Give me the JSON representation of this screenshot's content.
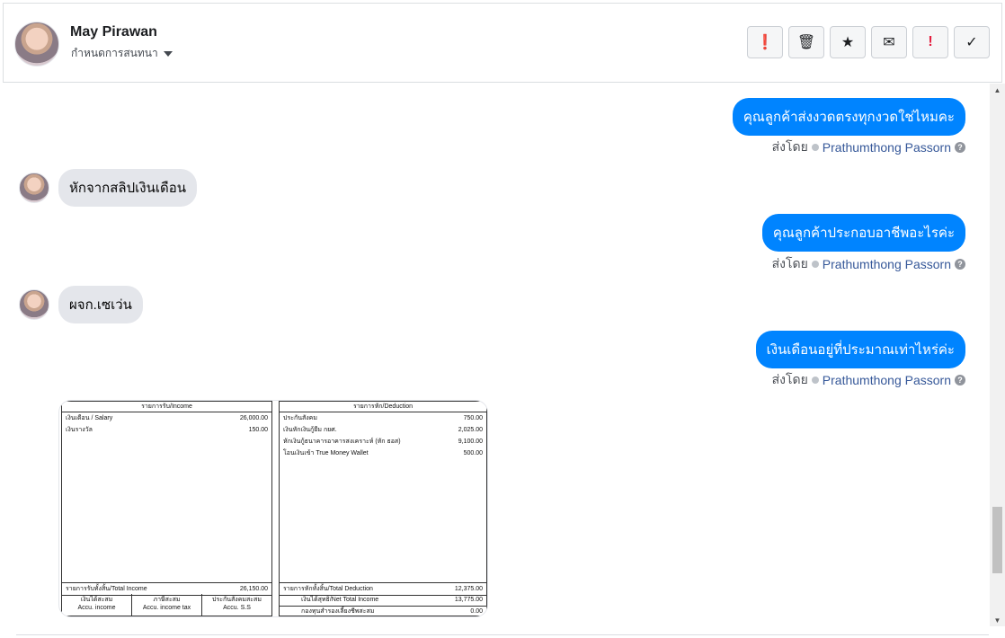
{
  "header": {
    "contact_name": "May Pirawan",
    "assign_label": "กำหนดการสนทนา",
    "actions": [
      {
        "name": "alert-button",
        "icon": "exclamation-circle-icon",
        "glyph": "❗"
      },
      {
        "name": "delete-button",
        "icon": "trash-icon",
        "glyph": "🗑"
      },
      {
        "name": "star-button",
        "icon": "star-icon",
        "glyph": "★"
      },
      {
        "name": "mark-unread-button",
        "icon": "envelope-icon",
        "glyph": "✉"
      },
      {
        "name": "spam-button",
        "icon": "exclamation-icon",
        "glyph": "!"
      },
      {
        "name": "done-button",
        "icon": "check-icon",
        "glyph": "✓"
      }
    ]
  },
  "messages": [
    {
      "direction": "out",
      "text": "คุณลูกค้าส่งงวดตรงทุกงวดใช่ไหมคะ"
    },
    {
      "direction": "in",
      "text": "หักจากสลิปเงินเดือน"
    },
    {
      "direction": "out",
      "text": "คุณลูกค้าประกอบอาชีพอะไรค่ะ"
    },
    {
      "direction": "in",
      "text": "ผจก.เซเว่น"
    },
    {
      "direction": "out",
      "text": "เงินเดือนอยู่ที่ประมาณเท่าไหร่ค่ะ"
    }
  ],
  "sent_by": {
    "prefix": "ส่งโดย",
    "agent": "Prathumthong Passorn"
  },
  "slip": {
    "income_header": "รายการรับ/Income",
    "income_items": [
      {
        "label": "เงินเดือน / Salary",
        "amount": "26,000.00"
      },
      {
        "label": "เงินรางวัล",
        "amount": "150.00"
      }
    ],
    "income_total_label": "รายการรับทั้งสิ้น/Total Income",
    "income_total": "26,150.00",
    "accum": [
      {
        "th": "เงินได้สะสม",
        "en": "Accu. income"
      },
      {
        "th": "ภาษีสะสม",
        "en": "Accu. income tax"
      },
      {
        "th": "ประกันสังคมสะสม",
        "en": "Accu. S.S"
      }
    ],
    "deduction_header": "รายการหัก/Deduction",
    "deduction_items": [
      {
        "label": "ประกันสังคม",
        "amount": "750.00"
      },
      {
        "label": "เงินหักเงินกู้ยืม กยศ.",
        "amount": "2,025.00"
      },
      {
        "label": "หักเงินกู้ธนาคารอาคารสงเคราะห์ (หัก ธอส)",
        "amount": "9,100.00"
      },
      {
        "label": "โอนเงินเข้า True Money Wallet",
        "amount": "500.00"
      }
    ],
    "deduction_total_label": "รายการหักทั้งสิ้น/Total Deduction",
    "deduction_total": "12,375.00",
    "net_label": "เงินได้สุทธิ/Net Total Income",
    "net_total": "13,775.00",
    "fund_label": "กองทุนสำรองเลี้ยงชีพสะสม",
    "fund_total": "0.00"
  },
  "colors": {
    "bubble_out": "#0084ff",
    "bubble_in": "#e4e6eb",
    "agent_link": "#365899",
    "spam_red": "#e41e3f"
  }
}
